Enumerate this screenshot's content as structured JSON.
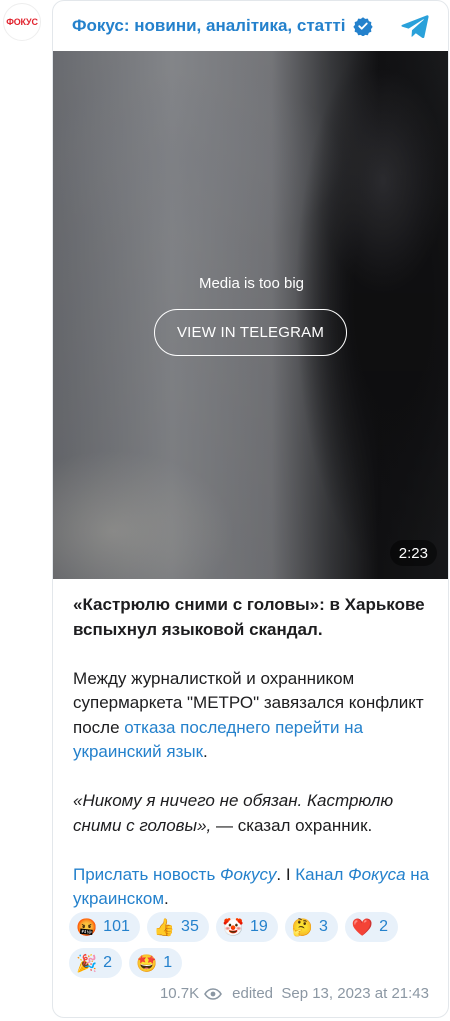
{
  "avatar": {
    "text": "ФОКУС",
    "color": "#e1232e"
  },
  "channel": {
    "title": "Фокус: новини, аналітика, статті",
    "verified_icon": "verified-badge-icon",
    "logo_icon": "telegram-logo-icon",
    "accent": "#2481cc"
  },
  "media": {
    "message": "Media is too big",
    "button_label": "VIEW IN TELEGRAM",
    "duration": "2:23"
  },
  "post": {
    "headline": "«Кастрюлю сними с головы»: в Харькове вспыхнул языковой скандал.",
    "body_part1": "Между журналисткой и охранником супермаркета \"МЕТРО\" завязался конфликт после ",
    "body_link": "отказа последнего перейти на украинский язык",
    "body_part2": ".",
    "quote_italic": "«Никому я ничего не обязан. Кастрюлю сними с головы»,",
    "quote_tail": " — сказал охранник.",
    "footer_link1_a": "Прислать новость ",
    "footer_link1_b": "Фокусу",
    "footer_dot": ".",
    "footer_sep": " I ",
    "footer_link2_a": "Канал ",
    "footer_link2_b": "Фокуса",
    "footer_link2_c": " на украинском",
    "footer_end": "."
  },
  "reactions": [
    {
      "emoji": "🤬",
      "count": "101"
    },
    {
      "emoji": "👍",
      "count": "35"
    },
    {
      "emoji": "🤡",
      "count": "19"
    },
    {
      "emoji": "🤔",
      "count": "3"
    },
    {
      "emoji": "❤️",
      "count": "2"
    },
    {
      "emoji": "🎉",
      "count": "2"
    },
    {
      "emoji": "🤩",
      "count": "1"
    }
  ],
  "meta": {
    "views": "10.7K",
    "edited_label": "edited",
    "date": "Sep 13, 2023 at 21:43"
  }
}
